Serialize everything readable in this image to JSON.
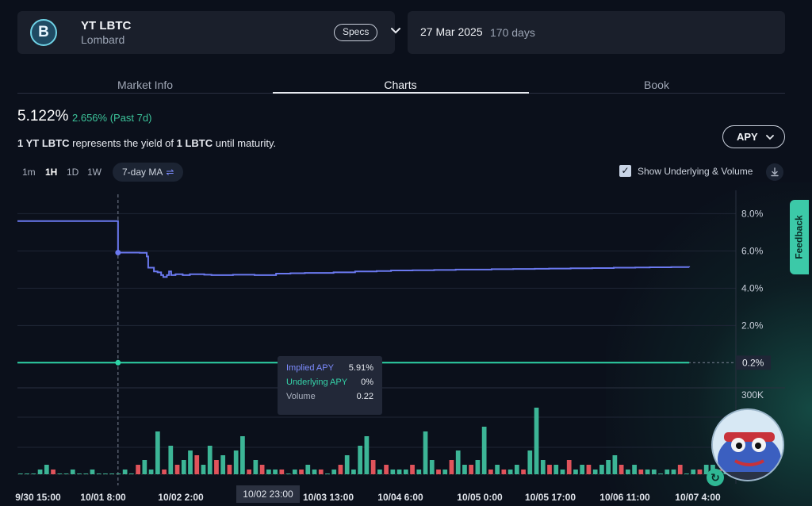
{
  "asset": {
    "name": "YT LBTC",
    "issuer": "Lombard",
    "icon": "bitcoin-b-icon",
    "specs_label": "Specs"
  },
  "maturity": {
    "date": "27 Mar 2025",
    "days": "170 days"
  },
  "tabs": [
    {
      "label": "Market Info"
    },
    {
      "label": "Charts",
      "active": true
    },
    {
      "label": "Book"
    }
  ],
  "summary": {
    "apy": "5.122%",
    "change": "2.656% (Past 7d)",
    "desc_pre": "1 YT LBTC",
    "desc_mid": " represents the yield of ",
    "desc_bold": "1 LBTC",
    "desc_post": " until maturity."
  },
  "metric_select": {
    "value": "APY"
  },
  "ranges": [
    "1m",
    "1H",
    "1D",
    "1W"
  ],
  "selected_range": "1H",
  "ma_label": "7-day MA",
  "show_underlying": {
    "label": "Show Underlying & Volume",
    "checked": true
  },
  "feedback_label": "Feedback",
  "tooltip": {
    "implied_label": "Implied APY",
    "implied_value": "5.91%",
    "underlying_label": "Underlying APY",
    "underlying_value": "0%",
    "volume_label": "Volume",
    "volume_value": "0.22"
  },
  "cursor_time": "10/02 23:00",
  "colors": {
    "implied": "#6b79f0",
    "underlying": "#2ed3a6",
    "up": "#3cb596",
    "down": "#e0535b",
    "bg": "#0b101b"
  },
  "chart_data": {
    "type": "line",
    "x_ticks": [
      "9/30 15:00",
      "10/01 8:00",
      "10/02 2:00",
      "10/02 23:00",
      "10/03 13:00",
      "10/04 6:00",
      "10/05 0:00",
      "10/05 17:00",
      "10/06 11:00",
      "10/07 4:00"
    ],
    "y_ticks": [
      "8.0%",
      "6.0%",
      "4.0%",
      "2.0%"
    ],
    "y_current_label": "0.2%",
    "volume_ticks": [
      "300K"
    ],
    "ylim": [
      -0.2,
      8.4
    ],
    "series": [
      {
        "name": "Implied APY",
        "x": [
          0,
          14,
          14,
          17,
          18,
          18.2,
          19,
          19.5,
          20,
          20.3,
          20.8,
          21.1,
          21.4,
          22,
          23,
          24,
          26,
          27,
          30,
          33,
          36,
          38,
          40,
          44,
          47,
          50,
          52,
          55,
          58,
          61,
          64,
          66,
          69,
          72,
          74,
          77,
          80,
          83,
          86,
          88,
          91,
          93.5
        ],
        "values": [
          7.6,
          7.6,
          5.91,
          5.9,
          5.7,
          5.1,
          4.9,
          4.85,
          4.7,
          4.6,
          4.7,
          4.9,
          4.7,
          4.75,
          4.7,
          4.75,
          4.72,
          4.7,
          4.72,
          4.7,
          4.78,
          4.8,
          4.82,
          4.85,
          4.9,
          4.92,
          4.95,
          4.96,
          4.98,
          5.0,
          5.0,
          5.02,
          5.03,
          5.04,
          5.05,
          5.07,
          5.08,
          5.1,
          5.11,
          5.12,
          5.13,
          5.12
        ]
      },
      {
        "name": "Underlying APY",
        "x": [
          0,
          93.5
        ],
        "values": [
          0,
          0
        ]
      }
    ],
    "volume": [
      0,
      0,
      0,
      1,
      2,
      1,
      0,
      0,
      1,
      0,
      0,
      1,
      0,
      0,
      0,
      0,
      1,
      0,
      2,
      3,
      1,
      9,
      1,
      6,
      2,
      3,
      5,
      4,
      2,
      6,
      3,
      4,
      2,
      5,
      8,
      1,
      3,
      2,
      1,
      1,
      1,
      0,
      1,
      1,
      2,
      1,
      1,
      0,
      1,
      2,
      4,
      1,
      6,
      8,
      3,
      1,
      2,
      1,
      1,
      1,
      2,
      1,
      9,
      3,
      1,
      1,
      3,
      5,
      2,
      2,
      3,
      10,
      1,
      2,
      1,
      1,
      2,
      1,
      5,
      14,
      3,
      2,
      2,
      1,
      3,
      1,
      2,
      2,
      1,
      2,
      3,
      4,
      2,
      1,
      2,
      1,
      1,
      1,
      0,
      1,
      1,
      2,
      0,
      1,
      1,
      2,
      2,
      1,
      4,
      3
    ],
    "volume_down": [
      0,
      0,
      0,
      0,
      0,
      1,
      0,
      0,
      0,
      0,
      0,
      0,
      0,
      0,
      0,
      0,
      0,
      0,
      1,
      0,
      2,
      0,
      1,
      0,
      1,
      0,
      0,
      1,
      0,
      0,
      1,
      0,
      1,
      0,
      0,
      1,
      0,
      1,
      0,
      0,
      1,
      0,
      0,
      1,
      0,
      0,
      1,
      0,
      0,
      1,
      0,
      0,
      0,
      0,
      1,
      0,
      1,
      0,
      0,
      0,
      1,
      0,
      0,
      0,
      1,
      0,
      1,
      0,
      0,
      1,
      0,
      0,
      1,
      0,
      1,
      0,
      0,
      1,
      0,
      0,
      0,
      1,
      0,
      0,
      1,
      0,
      0,
      1,
      0,
      0,
      0,
      0,
      1,
      0,
      0,
      1,
      0,
      0,
      0,
      0,
      0,
      1,
      0,
      0,
      1,
      0,
      0,
      1,
      0,
      0
    ],
    "grid": true
  }
}
